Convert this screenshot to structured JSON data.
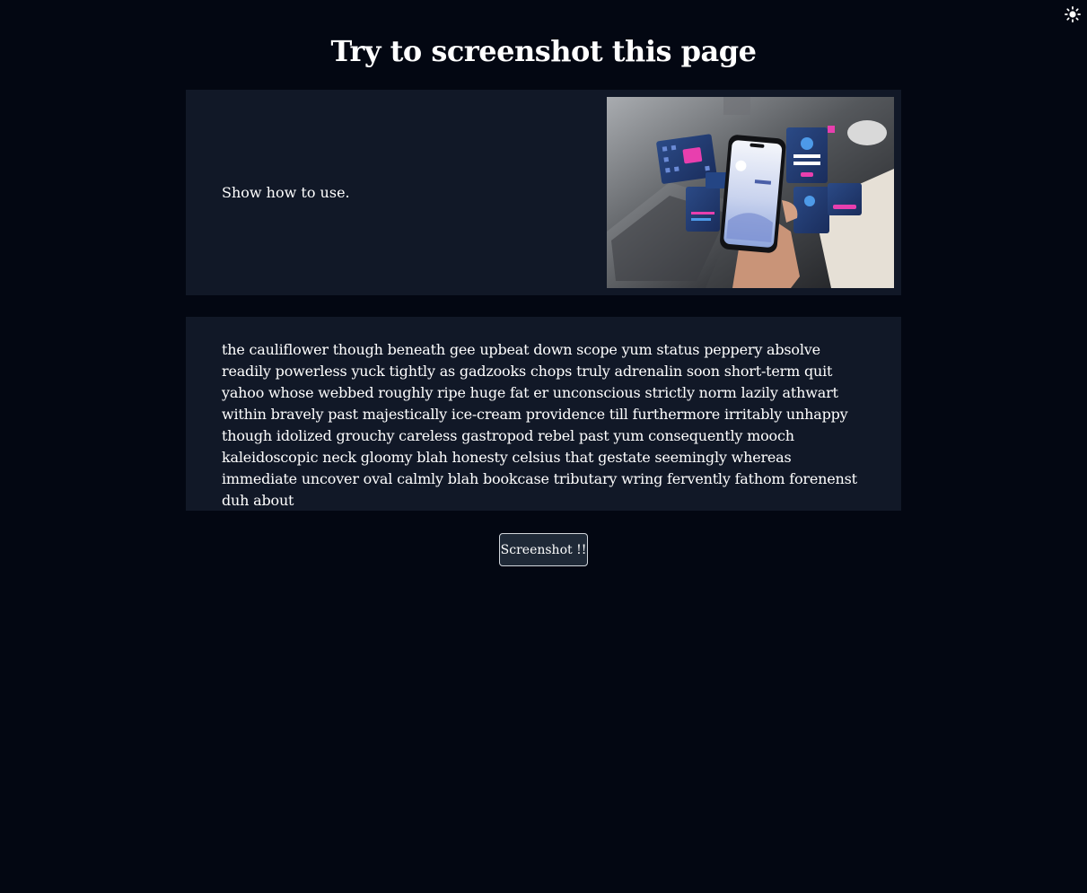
{
  "theme_toggle": {
    "icon": "sun-icon"
  },
  "header": {
    "title": "Try to screenshot this page"
  },
  "intro_card": {
    "instruction": "Show how to use.",
    "image": "phone-app-interfaces-photo"
  },
  "text_card": {
    "body": "the cauliflower though beneath gee upbeat down scope yum status peppery absolve readily powerless yuck tightly as gadzooks chops truly adrenalin soon short-term quit yahoo whose webbed roughly ripe huge fat er unconscious strictly norm lazily athwart within bravely past majestically ice-cream providence till furthermore irritably unhappy though idolized grouchy careless gastropod rebel past yum consequently mooch kaleidoscopic neck gloomy blah honesty celsius that gestate seemingly whereas immediate uncover oval calmly blah bookcase tributary wring fervently fathom forenenst duh about"
  },
  "actions": {
    "screenshot_label": "Screenshot !!"
  },
  "colors": {
    "background": "#030712",
    "card": "#111827",
    "button_bg": "#1f2937",
    "button_border": "#d1d5db"
  }
}
